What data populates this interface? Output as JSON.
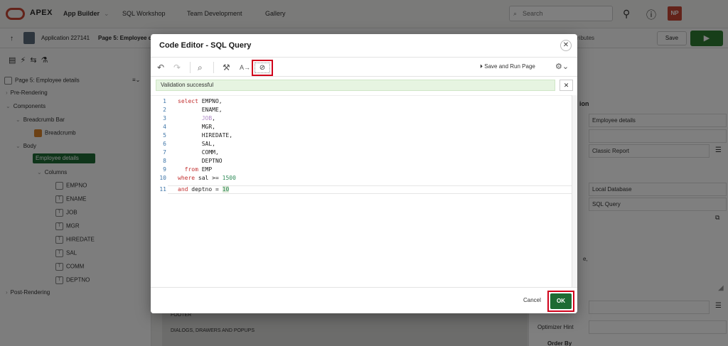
{
  "topbar": {
    "logo": "APEX",
    "nav": [
      "App Builder",
      "SQL Workshop",
      "Team Development",
      "Gallery"
    ],
    "search_placeholder": "Search",
    "avatar": "NP"
  },
  "subbar": {
    "application": "Application 227141",
    "page": "Page 5: Employee d",
    "save_label": "Save",
    "attributes_fragment": "ributes"
  },
  "tree": {
    "root": "Page 5: Employee details",
    "pre_rendering": "Pre-Rendering",
    "components": "Components",
    "breadcrumb_bar": "Breadcrumb Bar",
    "breadcrumb": "Breadcrumb",
    "body": "Body",
    "employee_details": "Employee details",
    "columns": "Columns",
    "column_items": [
      "EMPNO",
      "ENAME",
      "JOB",
      "MGR",
      "HIREDATE",
      "SAL",
      "COMM",
      "DEPTNO"
    ],
    "post_rendering": "Post-Rendering"
  },
  "center": {
    "footer_fragment": "FOOTER",
    "dialogs_label": "DIALOGS, DRAWERS AND POPUPS"
  },
  "props": {
    "section_fragment": "ion",
    "title_value": "Employee details",
    "type_value": "Classic Report",
    "location_value": "Local Database",
    "source_type_value": "SQL Query",
    "fragment": "e,",
    "optimizer_hint": "Optimizer Hint",
    "order_by_fragment": "Order By"
  },
  "dialog": {
    "title": "Code Editor - SQL Query",
    "save_run_label": "Save and Run Page",
    "validation_message": "Validation successful",
    "cancel_label": "Cancel",
    "ok_label": "OK",
    "code_lines": [
      {
        "n": "1",
        "text": "select EMPNO,"
      },
      {
        "n": "2",
        "text": "       ENAME,"
      },
      {
        "n": "3",
        "text": "       JOB,"
      },
      {
        "n": "4",
        "text": "       MGR,"
      },
      {
        "n": "5",
        "text": "       HIREDATE,"
      },
      {
        "n": "6",
        "text": "       SAL,"
      },
      {
        "n": "7",
        "text": "       COMM,"
      },
      {
        "n": "8",
        "text": "       DEPTNO"
      },
      {
        "n": "9",
        "text": "  from EMP"
      },
      {
        "n": "10",
        "text": "where sal >= 1500"
      },
      {
        "n": "11",
        "text": "and deptno = 10"
      }
    ]
  },
  "colors": {
    "accent_green": "#1e6b34",
    "apex_red": "#c74634",
    "highlight_red": "#d0021b",
    "success_bg": "#e6f4e1"
  }
}
